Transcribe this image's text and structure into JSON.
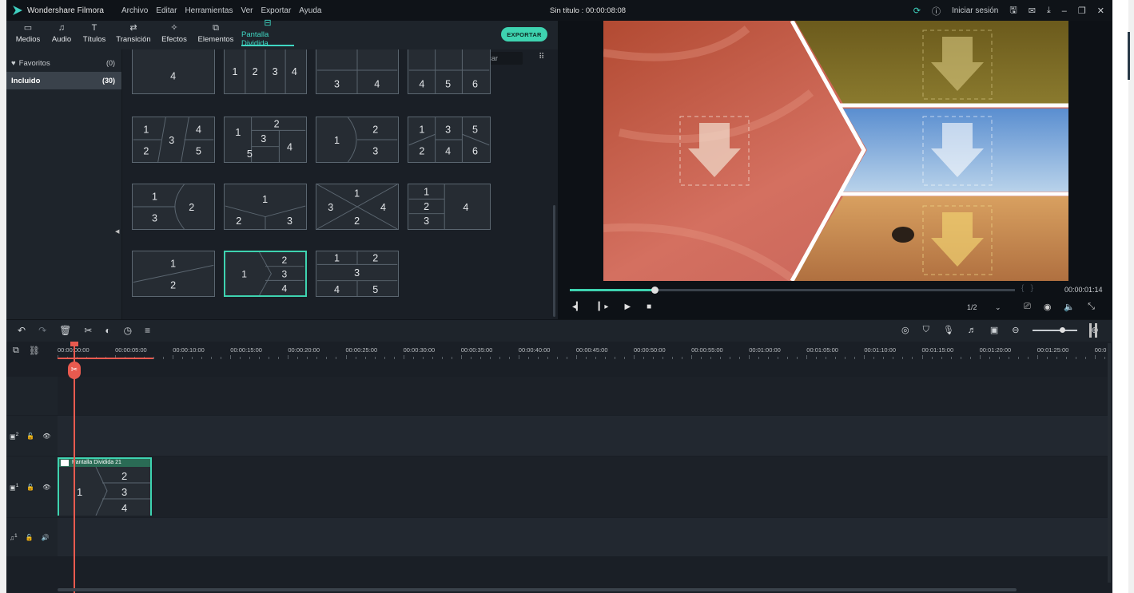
{
  "app": {
    "name": "Wondershare Filmora",
    "doc_title": "Sin título : 00:00:08:08"
  },
  "menu": [
    "Archivo",
    "Editar",
    "Herramientas",
    "Ver",
    "Exportar",
    "Ayuda"
  ],
  "titlebar_right": {
    "login": "Iniciar sesión"
  },
  "toolbar": {
    "tabs": [
      {
        "label": "Medios",
        "icon": "folder-icon"
      },
      {
        "label": "Audio",
        "icon": "music-icon"
      },
      {
        "label": "Títulos",
        "icon": "text-icon"
      },
      {
        "label": "Transición",
        "icon": "transition-icon"
      },
      {
        "label": "Efectos",
        "icon": "effects-icon"
      },
      {
        "label": "Elementos",
        "icon": "elements-icon"
      },
      {
        "label": "Pantalla Dividida",
        "icon": "split-screen-icon",
        "active": true
      }
    ],
    "export": "EXPORTAR"
  },
  "sidebar": {
    "items": [
      {
        "label": "Favoritos",
        "count": "(0)"
      },
      {
        "label": "Incluido",
        "count": "(30)"
      }
    ]
  },
  "library": {
    "search_placeholder": "Buscar"
  },
  "preview": {
    "timecode": "00:00:01:14",
    "ratio": "1/2",
    "progress": 0.19
  },
  "timeline": {
    "ruler": [
      "00:00:00:00",
      "00:00:05:00",
      "00:00:10:00",
      "00:00:15:00",
      "00:00:20:00",
      "00:00:25:00",
      "00:00:30:00",
      "00:00:35:00",
      "00:00:40:00",
      "00:00:45:00",
      "00:00:50:00",
      "00:00:55:00",
      "00:01:00:00",
      "00:01:05:00",
      "00:01:10:00",
      "00:01:15:00",
      "00:01:20:00",
      "00:01:25:00",
      "00:0"
    ],
    "clip_title": "Pantalla Dividida 21",
    "track_labels": {
      "v2": "2",
      "v1": "1",
      "a1": "1"
    }
  },
  "colors": {
    "accent": "#3ed3b0",
    "playhead": "#e85a4f"
  }
}
